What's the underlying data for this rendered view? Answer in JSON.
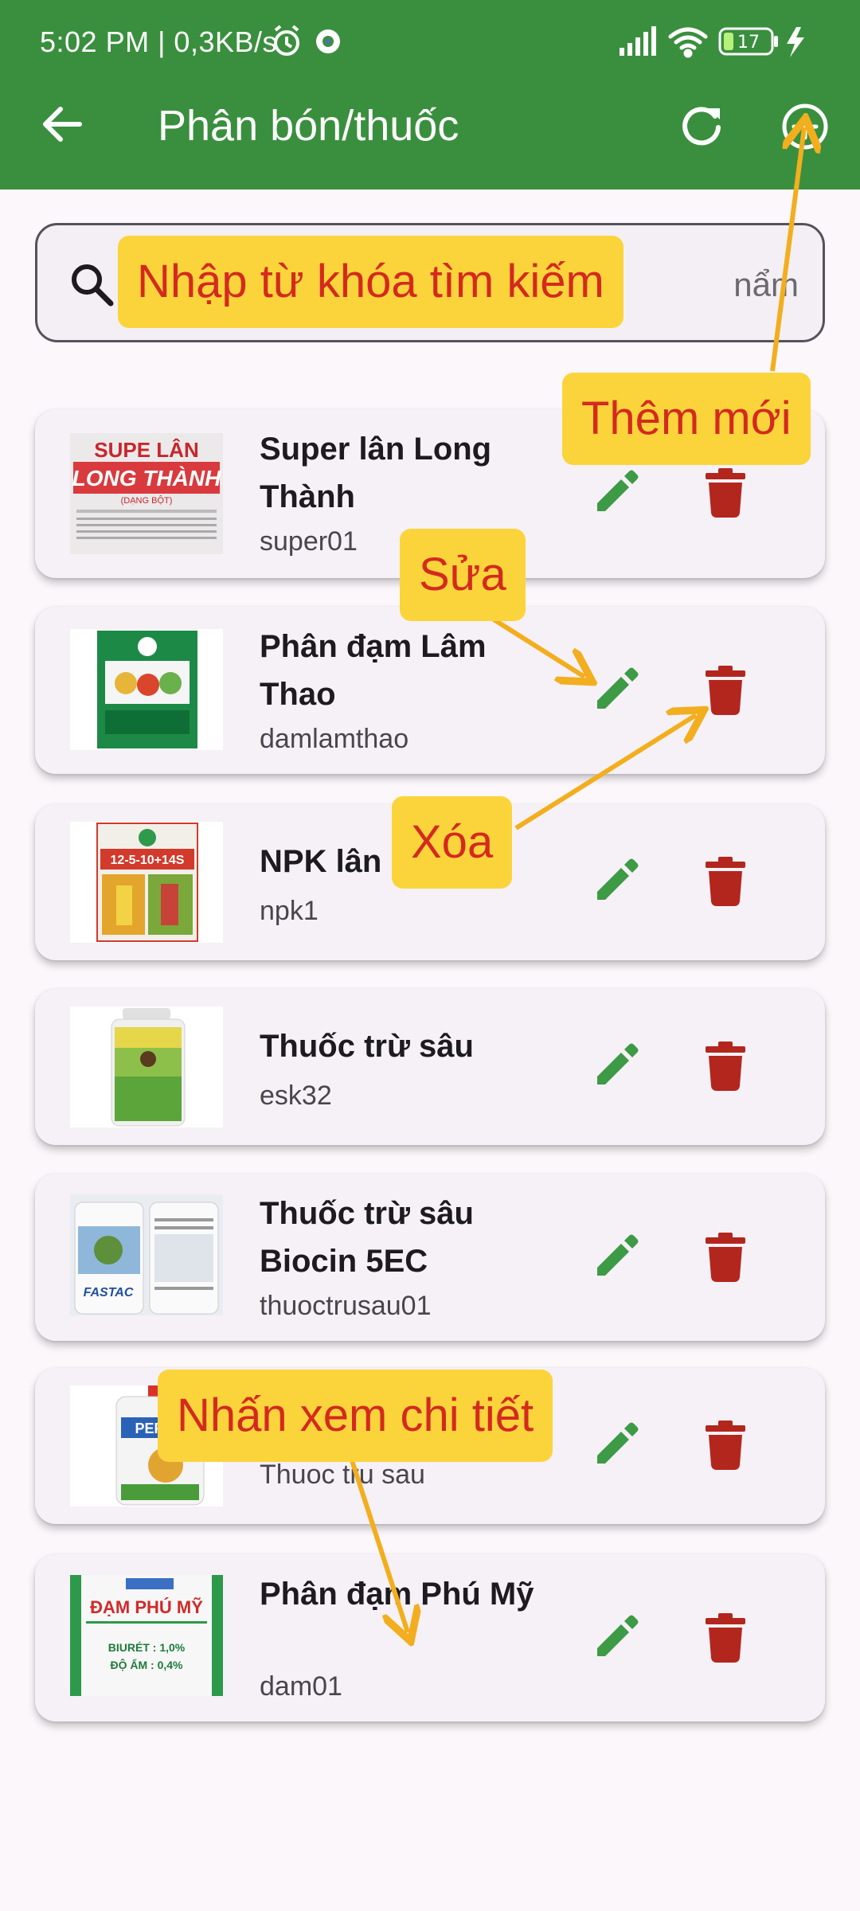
{
  "status_bar": {
    "time_speed": "5:02 PM | 0,3KB/s",
    "battery": "17"
  },
  "app_bar": {
    "title": "Phân bón/thuốc"
  },
  "search": {
    "placeholder_visible_tail": "nẩm"
  },
  "items": [
    {
      "name": "Super lân Long Thành",
      "code": "super01"
    },
    {
      "name": "Phân đạm Lâm Thao",
      "code": "damlamthao"
    },
    {
      "name": "NPK lân",
      "code": "npk1"
    },
    {
      "name": "Thuốc trừ sâu",
      "code": "esk32"
    },
    {
      "name": "Thuốc trừ sâu Biocin 5EC",
      "code": "thuoctrusau01"
    },
    {
      "name": "",
      "code": "Thuoc tru sau"
    },
    {
      "name": "Phân đạm Phú Mỹ",
      "code": "dam01"
    }
  ],
  "thumb_text": {
    "t0_l1": "SUPE LÂN",
    "t0_l2": "LONG THÀNH",
    "t0_l3": "(DẠNG BỘT)",
    "t2_l1": "12-5-10+14S",
    "t4_l1": "FASTAC",
    "t5_l1": "PERAN",
    "t6_l1": "ĐẠM PHÚ MỸ",
    "t6_l2": "BIURÉT : 1,0%",
    "t6_l3": "ĐỘ ẨM : 0,4%"
  },
  "callouts": {
    "search": "Nhập từ khóa tìm kiếm",
    "add": "Thêm mới",
    "edit": "Sửa",
    "delete": "Xóa",
    "detail": "Nhấn xem chi tiết"
  },
  "colors": {
    "primary_green": "#3a8f3e",
    "icon_green": "#3d9a45",
    "delete_red": "#b3261e",
    "callout_bg": "#fbd43c",
    "callout_text": "#d42a1e",
    "arrow": "#f2ae1e"
  },
  "icons": [
    "back-arrow-icon",
    "refresh-icon",
    "add-circle-icon",
    "search-icon",
    "edit-pencil-icon",
    "delete-trash-icon",
    "alarm-icon",
    "settings-gear-icon",
    "signal-icon",
    "wifi-icon",
    "battery-icon",
    "charging-bolt-icon"
  ]
}
